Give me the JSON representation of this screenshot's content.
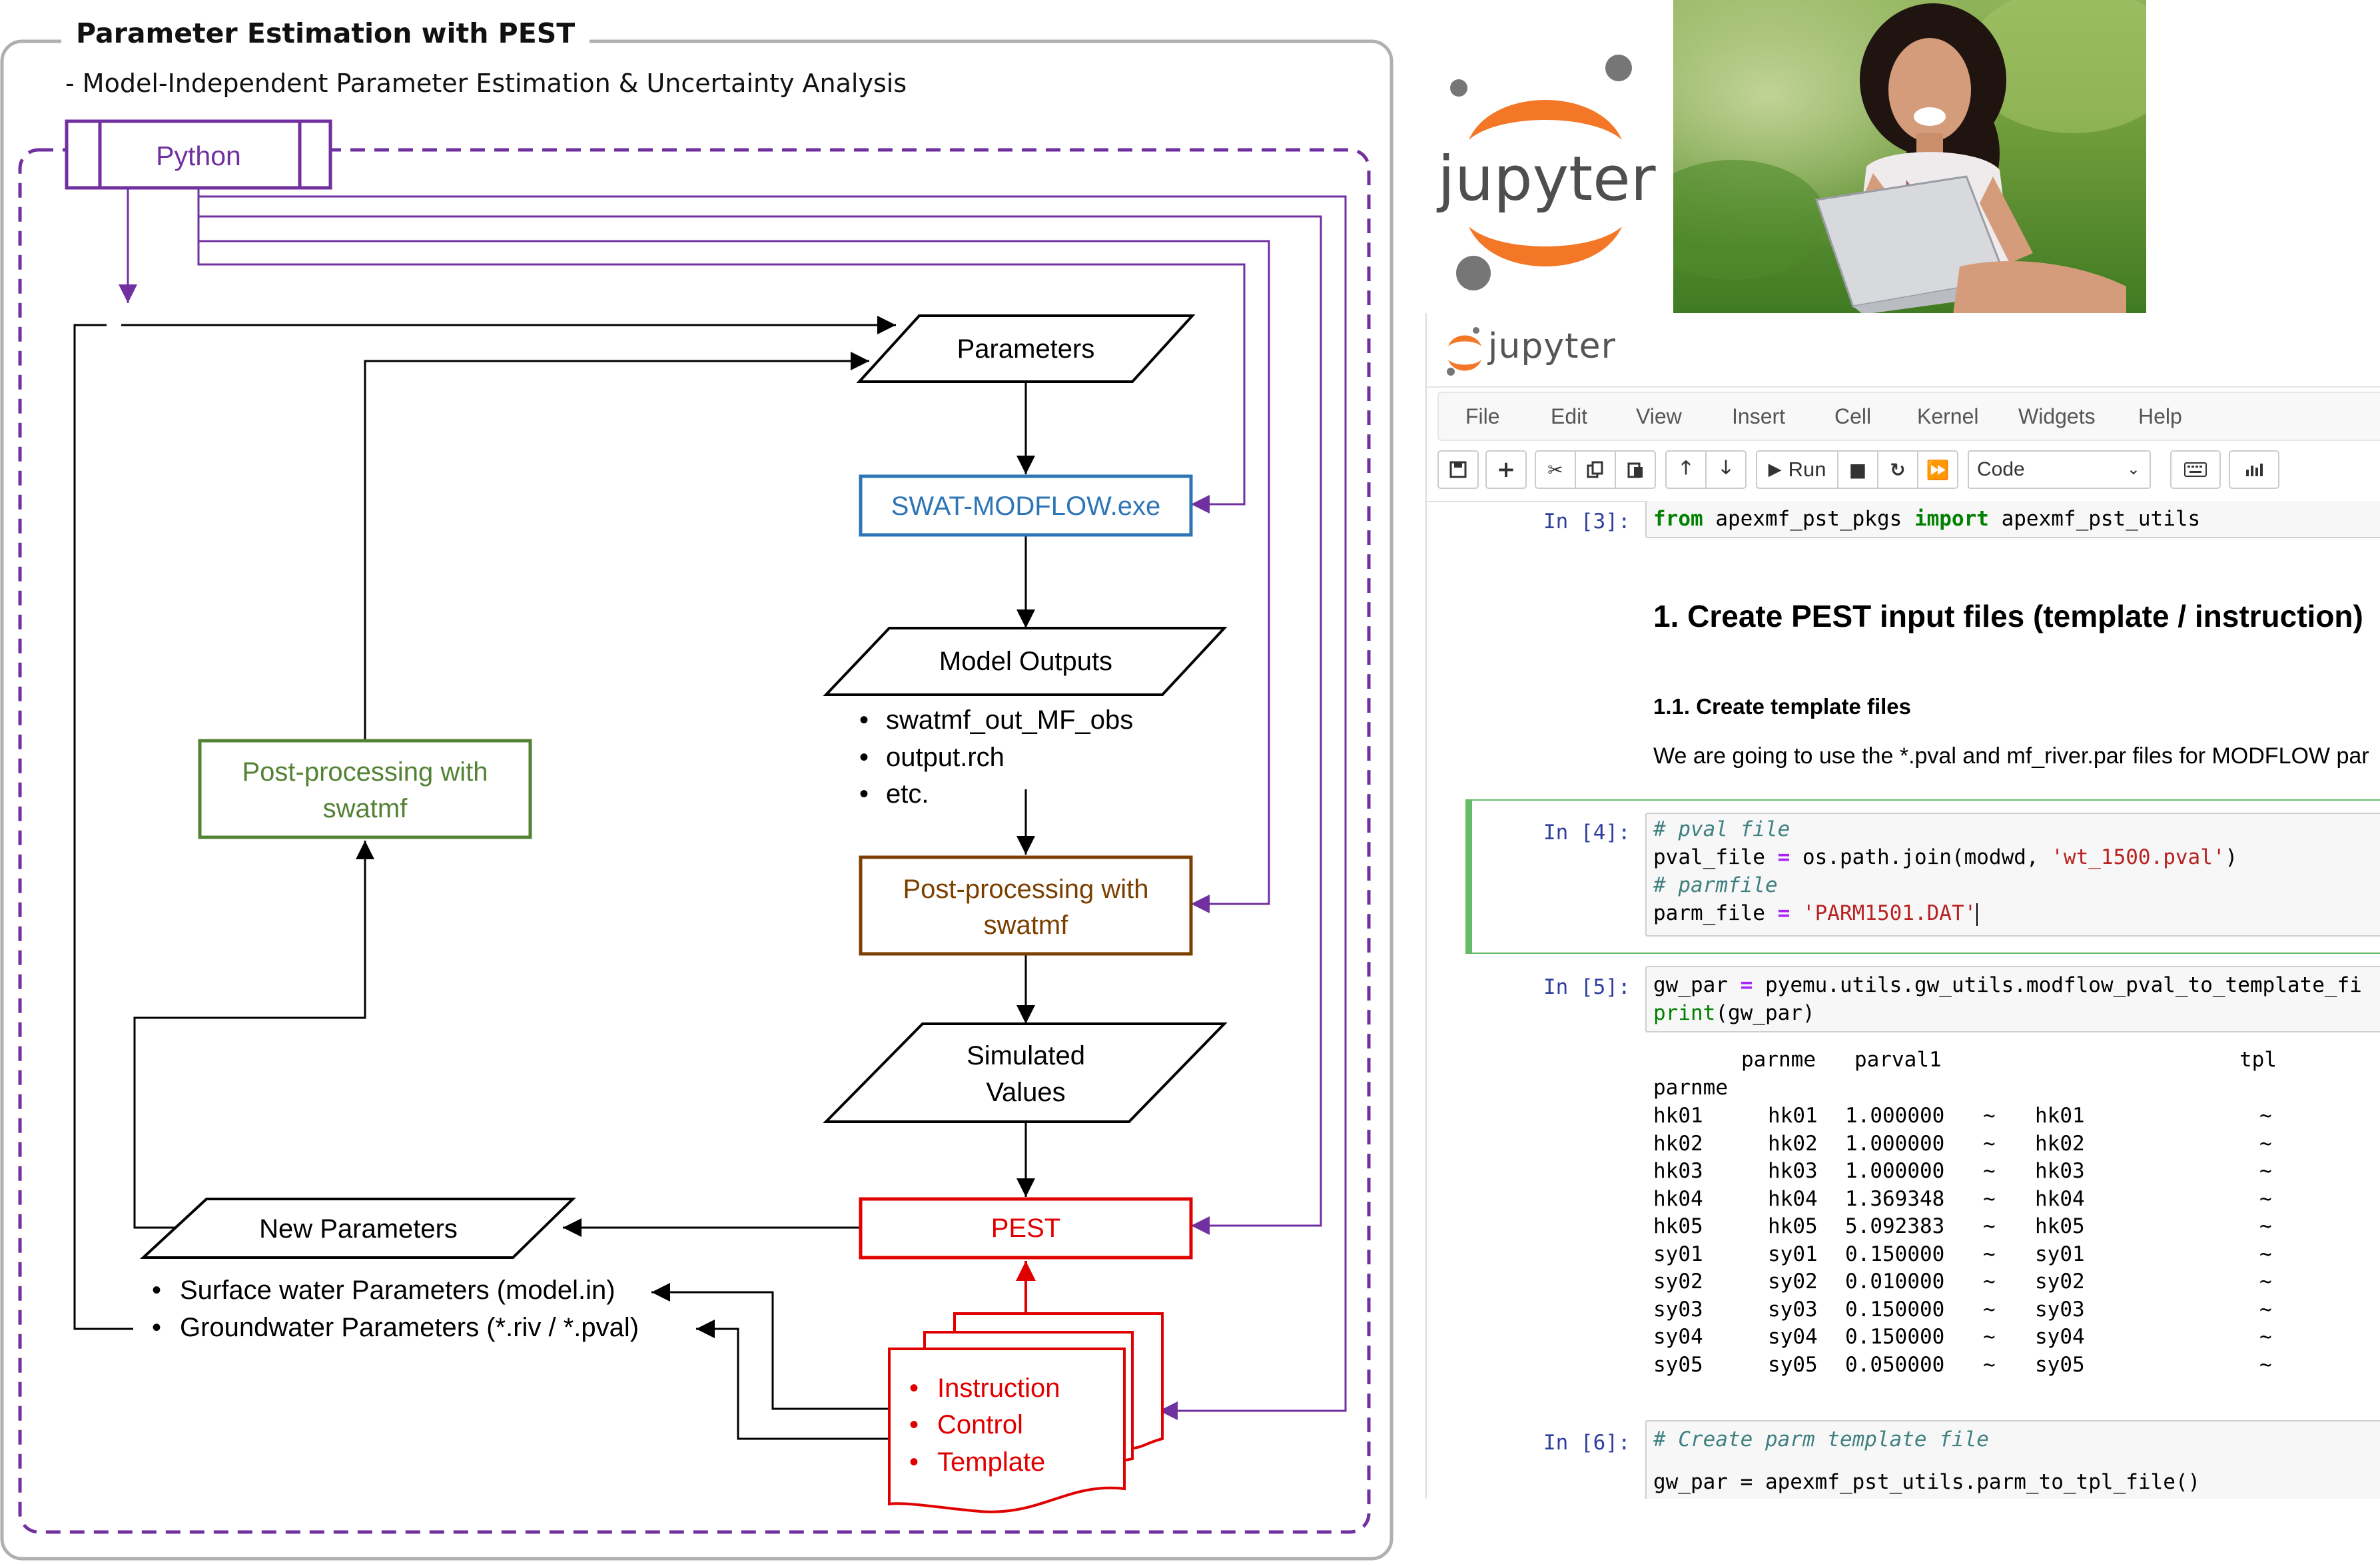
{
  "diagram": {
    "title": "Parameter Estimation with PEST",
    "subtitle": "- Model-Independent Parameter Estimation & Uncertainty Analysis",
    "nodes": {
      "python": "Python",
      "parameters": "Parameters",
      "swat_modflow": "SWAT-MODFLOW.exe",
      "model_outputs": "Model Outputs",
      "model_outputs_items": [
        "swatmf_out_MF_obs",
        "output.rch",
        "etc."
      ],
      "postproc_right_line1": "Post-processing with",
      "postproc_right_line2": "swatmf",
      "postproc_left_line1": "Post-processing with",
      "postproc_left_line2": "swatmf",
      "simulated_line1": "Simulated",
      "simulated_line2": "Values",
      "pest": "PEST",
      "new_parameters": "New Parameters",
      "new_parameters_items": [
        "Surface water Parameters (model.in)",
        "Groundwater Parameters (*.riv / *.pval)"
      ],
      "pest_files": [
        "Instruction",
        "Control",
        "Template"
      ]
    },
    "colors": {
      "python": "#7030a0",
      "swat_modflow": "#2e75b6",
      "postproc_right": "#7b3f00",
      "postproc_left": "#548235",
      "pest": "#e00000",
      "black": "#000000"
    }
  },
  "notebook": {
    "brand": "jupyter",
    "menu": [
      "File",
      "Edit",
      "View",
      "Insert",
      "Cell",
      "Kernel",
      "Widgets",
      "Help"
    ],
    "toolbar": {
      "run_label": "Run",
      "cell_type": "Code",
      "icons": [
        "save-icon",
        "plus-icon",
        "cut-icon",
        "copy-icon",
        "paste-icon",
        "arrow-up-icon",
        "arrow-down-icon",
        "run-icon",
        "stop-icon",
        "restart-icon",
        "fast-forward-icon",
        "keyboard-icon",
        "chart-icon"
      ]
    },
    "cells": {
      "c3_prompt": "In [3]:",
      "c3": {
        "from": "from",
        "module": " apexmf_pst_pkgs ",
        "import": "import",
        "name": " apexmf_pst_utils"
      },
      "h1": "1. Create PEST input files (template / instruction)",
      "h3": "1.1. Create template files",
      "p": "We are going to use the *.pval and mf_river.par files for MODFLOW par",
      "c4_prompt": "In [4]:",
      "c4": {
        "comment1": "# pval file",
        "l2_var": "pval_file ",
        "l2_eq": "=",
        "l2_call": " os.path.join(modwd, ",
        "l2_str": "'wt_1500.pval'",
        "l2_end": ")",
        "comment2": "# parmfile",
        "l4_var": "parm_file ",
        "l4_eq": "=",
        "l4_str": " 'PARM1501.DAT'"
      },
      "c5_prompt": "In [5]:",
      "c5": {
        "l1_var": "gw_par ",
        "l1_eq": "=",
        "l1_rest": " pyemu.utils.gw_utils.modflow_pval_to_template_fi",
        "l2_print": "print",
        "l2_rest": "(gw_par)"
      },
      "output": {
        "headers": [
          "parnme",
          "parval1",
          "tpl"
        ],
        "index_name": "parnme",
        "rows": [
          [
            "hk01",
            "hk01",
            "1.000000",
            "~",
            "hk01",
            "~"
          ],
          [
            "hk02",
            "hk02",
            "1.000000",
            "~",
            "hk02",
            "~"
          ],
          [
            "hk03",
            "hk03",
            "1.000000",
            "~",
            "hk03",
            "~"
          ],
          [
            "hk04",
            "hk04",
            "1.369348",
            "~",
            "hk04",
            "~"
          ],
          [
            "hk05",
            "hk05",
            "5.092383",
            "~",
            "hk05",
            "~"
          ],
          [
            "sy01",
            "sy01",
            "0.150000",
            "~",
            "sy01",
            "~"
          ],
          [
            "sy02",
            "sy02",
            "0.010000",
            "~",
            "sy02",
            "~"
          ],
          [
            "sy03",
            "sy03",
            "0.150000",
            "~",
            "sy03",
            "~"
          ],
          [
            "sy04",
            "sy04",
            "0.150000",
            "~",
            "sy04",
            "~"
          ],
          [
            "sy05",
            "sy05",
            "0.050000",
            "~",
            "sy05",
            "~"
          ]
        ]
      },
      "c6_prompt": "In [6]:",
      "c6_comment": "# Create parm template file",
      "c6_cut": "gw_par = apexmf_pst_utils.parm_to_tpl_file()"
    }
  },
  "logo_big_text": "jupyter"
}
